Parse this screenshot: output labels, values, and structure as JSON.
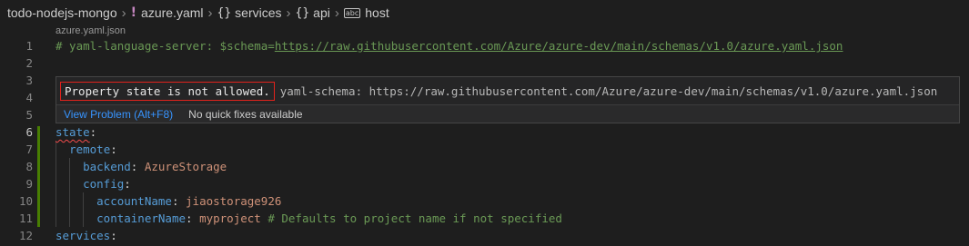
{
  "breadcrumb": {
    "project": "todo-nodejs-mongo",
    "file": "azure.yaml",
    "services": "services",
    "api": "api",
    "host": "host"
  },
  "codelens": "azure.yaml.json",
  "line_numbers": [
    "1",
    "2",
    "3",
    "4",
    "5",
    "6",
    "7",
    "8",
    "9",
    "10",
    "11",
    "12"
  ],
  "code": {
    "line1_prefix": "# yaml-language-server: $schema=",
    "line1_url": "https://raw.githubusercontent.com/Azure/azure-dev/main/schemas/v1.0/azure.yaml.json",
    "state_key": "state",
    "remote_key": "remote",
    "backend_key": "backend",
    "backend_value": "AzureStorage",
    "config_key": "config",
    "accountName_key": "accountName",
    "accountName_value": "jiaostorage926",
    "containerName_key": "containerName",
    "containerName_value": "myproject",
    "containerName_comment": "# Defaults to project name if not specified",
    "services_key": "services"
  },
  "hover": {
    "message": "Property state is not allowed.",
    "source": "yaml-schema: https://raw.githubusercontent.com/Azure/azure-dev/main/schemas/v1.0/azure.yaml.json",
    "view_problem": "View Problem (Alt+F8)",
    "no_fixes": "No quick fixes available"
  }
}
